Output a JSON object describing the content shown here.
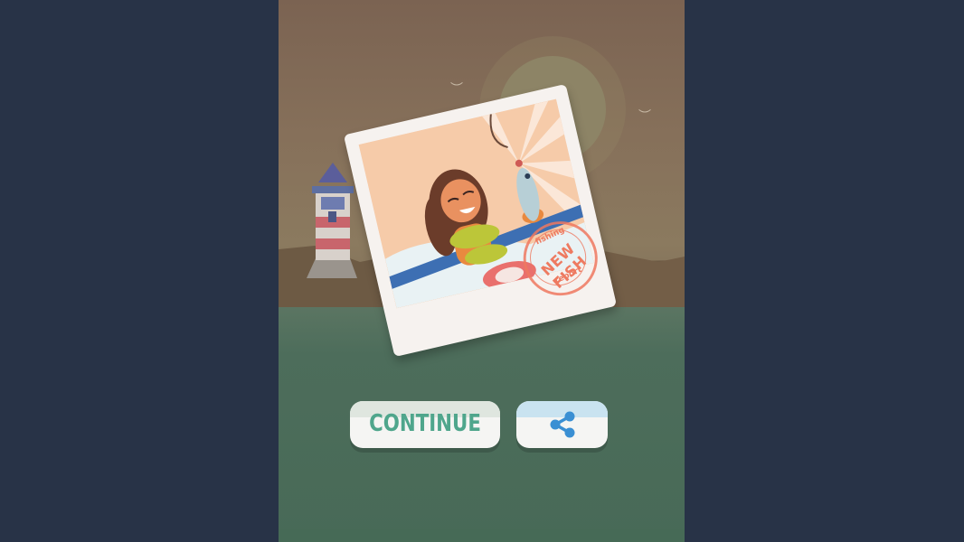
{
  "screen": "new-fish-photo",
  "colors": {
    "sidebar": "#283347",
    "sky": "#7b6352",
    "water": "#476954",
    "continue_text": "#4fa68c",
    "share_icon": "#3a8fd3",
    "stamp": "#ee7a60"
  },
  "photo": {
    "stamp": {
      "top_text": "fishing",
      "main_text": "NEW FISH",
      "bottom_text": "report"
    }
  },
  "buttons": {
    "continue_label": "CONTINUE",
    "share_icon": "share-icon"
  }
}
